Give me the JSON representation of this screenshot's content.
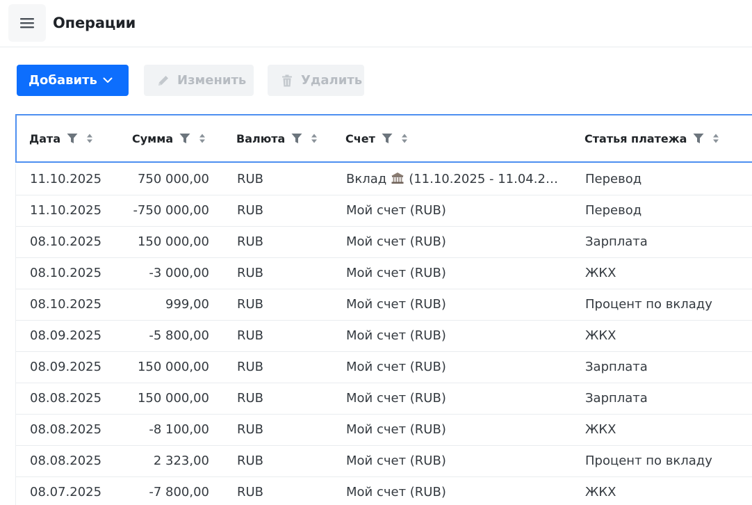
{
  "header": {
    "title": "Операции"
  },
  "toolbar": {
    "add_label": "Добавить",
    "edit_label": "Изменить",
    "delete_label": "Удалить"
  },
  "table": {
    "columns": [
      "Дата",
      "Сумма",
      "Валюта",
      "Счет",
      "Статья платежа"
    ],
    "rows": [
      {
        "date": "11.10.2025",
        "amount": "750 000,00",
        "currency": "RUB",
        "account_prefix": "Вклад",
        "account_icon": "bank-icon",
        "account": "(11.10.2025 - 11.04.20...",
        "article": "Перевод"
      },
      {
        "date": "11.10.2025",
        "amount": "-750 000,00",
        "currency": "RUB",
        "account_prefix": "",
        "account": "Мой счет (RUB)",
        "article": "Перевод"
      },
      {
        "date": "08.10.2025",
        "amount": "150 000,00",
        "currency": "RUB",
        "account_prefix": "",
        "account": "Мой счет (RUB)",
        "article": "Зарплата"
      },
      {
        "date": "08.10.2025",
        "amount": "-3 000,00",
        "currency": "RUB",
        "account_prefix": "",
        "account": "Мой счет (RUB)",
        "article": "ЖКХ"
      },
      {
        "date": "08.10.2025",
        "amount": "999,00",
        "currency": "RUB",
        "account_prefix": "",
        "account": "Мой счет (RUB)",
        "article": "Процент по вкладу"
      },
      {
        "date": "08.09.2025",
        "amount": "-5 800,00",
        "currency": "RUB",
        "account_prefix": "",
        "account": "Мой счет (RUB)",
        "article": "ЖКХ"
      },
      {
        "date": "08.09.2025",
        "amount": "150 000,00",
        "currency": "RUB",
        "account_prefix": "",
        "account": "Мой счет (RUB)",
        "article": "Зарплата"
      },
      {
        "date": "08.08.2025",
        "amount": "150 000,00",
        "currency": "RUB",
        "account_prefix": "",
        "account": "Мой счет (RUB)",
        "article": "Зарплата"
      },
      {
        "date": "08.08.2025",
        "amount": "-8 100,00",
        "currency": "RUB",
        "account_prefix": "",
        "account": "Мой счет (RUB)",
        "article": "ЖКХ"
      },
      {
        "date": "08.08.2025",
        "amount": "2 323,00",
        "currency": "RUB",
        "account_prefix": "",
        "account": "Мой счет (RUB)",
        "article": "Процент по вкладу"
      },
      {
        "date": "08.07.2025",
        "amount": "-7 800,00",
        "currency": "RUB",
        "account_prefix": "",
        "account": "Мой счет (RUB)",
        "article": "ЖКХ"
      }
    ]
  },
  "colors": {
    "primary": "#0d6efd",
    "header_border": "#4d8ff0",
    "disabled_bg": "#f1f3f5",
    "disabled_text": "#b7bcc2"
  }
}
